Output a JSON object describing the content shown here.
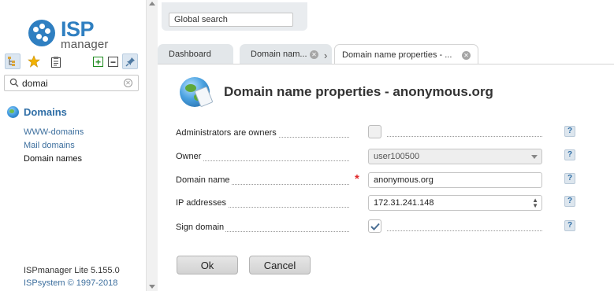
{
  "brand": {
    "logo_isp": "ISP",
    "logo_manager": "manager",
    "color": "#2f7fc1"
  },
  "sidebar": {
    "toolbar": [
      {
        "icon": "tree-icon"
      },
      {
        "icon": "star-icon"
      },
      {
        "icon": "clipboard-icon"
      },
      {
        "icon": "expand-plus-icon"
      },
      {
        "icon": "collapse-minus-icon"
      },
      {
        "icon": "pin-icon"
      }
    ],
    "search_value": "domai",
    "group_label": "Domains",
    "items": [
      {
        "label": "WWW-domains"
      },
      {
        "label": "Mail domains"
      },
      {
        "label": "Domain names"
      }
    ],
    "footer": {
      "version": "ISPmanager Lite 5.155.0",
      "copyright": "ISPsystem © 1997-2018"
    }
  },
  "header": {
    "global_search_placeholder": "Global search",
    "tabs": [
      {
        "label": "Dashboard"
      },
      {
        "label": "Domain nam..."
      },
      {
        "label": "Domain name properties - ..."
      }
    ]
  },
  "form": {
    "title": "Domain name properties - anonymous.org",
    "fields": {
      "admins_owners": {
        "label": "Administrators are owners",
        "checked": false
      },
      "owner": {
        "label": "Owner",
        "value": "user100500"
      },
      "domain_name": {
        "label": "Domain name",
        "value": "anonymous.org",
        "required_mark": "*"
      },
      "ip_addresses": {
        "label": "IP addresses",
        "value": "172.31.241.148"
      },
      "sign_domain": {
        "label": "Sign domain",
        "checked": true
      }
    },
    "help_label": "?",
    "ok_label": "Ok",
    "cancel_label": "Cancel"
  }
}
